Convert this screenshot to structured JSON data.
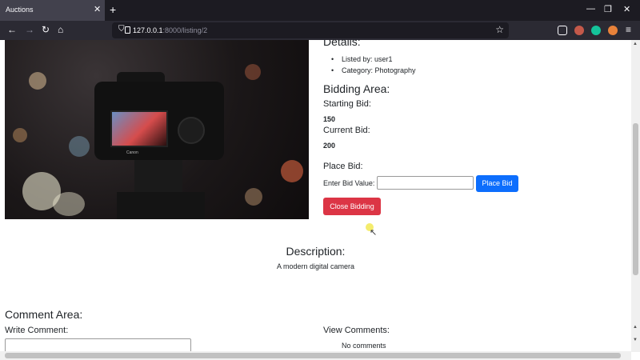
{
  "browser": {
    "tab_title": "Auctions",
    "tab_close": "✕",
    "new_tab": "+",
    "url_host": "127.0.0.1",
    "url_path": ":8000/listing/2",
    "window_controls": [
      "—",
      "❐",
      "✕"
    ]
  },
  "listing": {
    "details_heading": "Details:",
    "details": [
      "Listed by: user1",
      "Category: Photography"
    ],
    "camera_brand": "Canon"
  },
  "bidding": {
    "heading": "Bidding Area:",
    "starting_label": "Starting Bid:",
    "starting_value": "150",
    "current_label": "Current Bid:",
    "current_value": "200",
    "place_label": "Place Bid:",
    "enter_label": "Enter Bid Value:",
    "enter_value": "",
    "place_button": "Place Bid",
    "close_button": "Close Bidding"
  },
  "description": {
    "heading": "Description:",
    "text": "A modern digital camera"
  },
  "comments": {
    "heading": "Comment Area:",
    "write_label": "Write Comment:",
    "write_value": "",
    "view_label": "View Comments:",
    "empty_text": "No comments"
  },
  "colors": {
    "primary": "#0d6efd",
    "danger": "#dc3545",
    "chrome_dark": "#1c1b22",
    "chrome_toolbar": "#2b2a33"
  },
  "icons": [
    "back-icon",
    "forward-icon",
    "reload-icon",
    "home-icon",
    "shield-icon",
    "page-icon",
    "bookmark-star-icon",
    "pocket-icon",
    "extension-icon",
    "grammarly-icon",
    "account-icon",
    "menu-icon"
  ]
}
